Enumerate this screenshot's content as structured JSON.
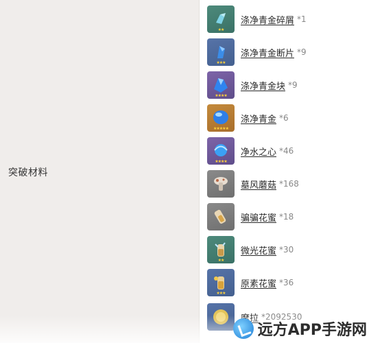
{
  "section": {
    "label": "突破材料"
  },
  "items": [
    {
      "name": "涤净青金碎屑",
      "count": "*1",
      "stars": "★★",
      "tier": "green",
      "icon": "crystal-shard-icon"
    },
    {
      "name": "涤净青金断片",
      "count": "*9",
      "stars": "★★★",
      "tier": "blue",
      "icon": "crystal-fragment-icon"
    },
    {
      "name": "涤净青金块",
      "count": "*9",
      "stars": "★★★★",
      "tier": "purple",
      "icon": "crystal-chunk-icon"
    },
    {
      "name": "涤净青金",
      "count": "*6",
      "stars": "★★★★★",
      "tier": "gold",
      "icon": "crystal-gemstone-icon"
    },
    {
      "name": "净水之心",
      "count": "*46",
      "stars": "★★★★",
      "tier": "purple",
      "icon": "water-heart-icon"
    },
    {
      "name": "墓风蘑菇",
      "count": "*168",
      "stars": "",
      "tier": "gray",
      "icon": "mushroom-icon"
    },
    {
      "name": "骗骗花蜜",
      "count": "*18",
      "stars": "",
      "tier": "gray",
      "icon": "nectar-vial-icon"
    },
    {
      "name": "微光花蜜",
      "count": "*30",
      "stars": "★★",
      "tier": "green",
      "icon": "shimmering-nectar-icon"
    },
    {
      "name": "原素花蜜",
      "count": "*36",
      "stars": "★★★",
      "tier": "blue",
      "icon": "energy-nectar-icon"
    },
    {
      "name": "摩拉",
      "count": "*2092530",
      "stars": "",
      "tier": "blue",
      "icon": "mora-coin-icon"
    }
  ],
  "watermark": {
    "text": "远方APP手游网",
    "icon": "watermark-logo-icon"
  }
}
